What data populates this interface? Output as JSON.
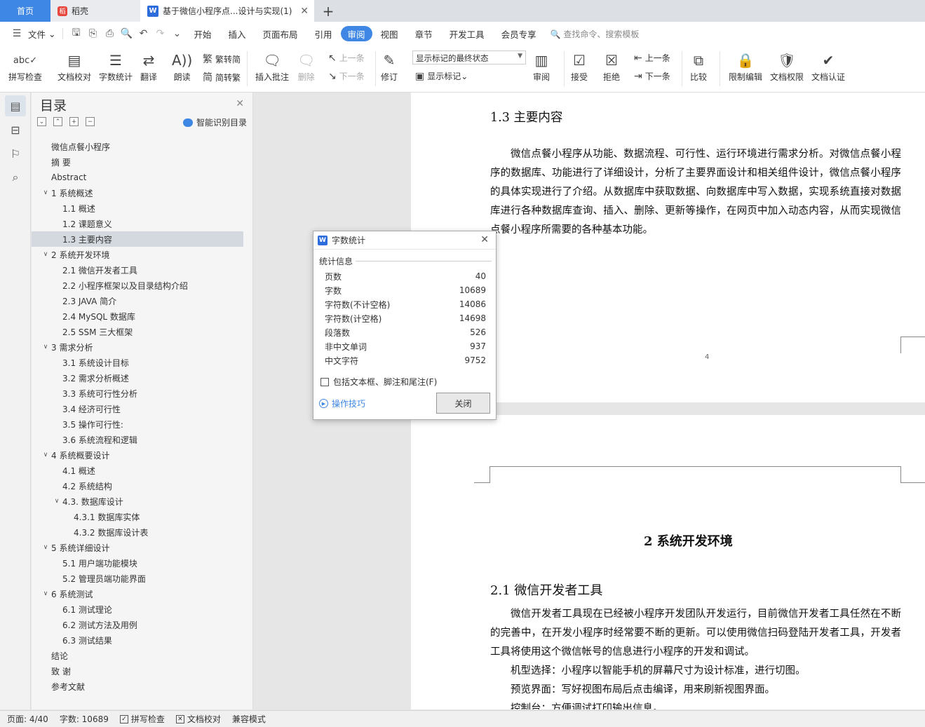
{
  "tabs": {
    "home": "首页",
    "daoke": "稻壳",
    "doc": "基于微信小程序点...设计与实现(1)"
  },
  "menu": {
    "file": "文件",
    "items": [
      "开始",
      "插入",
      "页面布局",
      "引用",
      "审阅",
      "视图",
      "章节",
      "开发工具",
      "会员专享"
    ],
    "active": "审阅",
    "search_placeholder": "查找命令、搜索模板"
  },
  "ribbon": {
    "spell": "拼写检查",
    "proofread": "文档校对",
    "wordcount": "字数统计",
    "translate": "翻译",
    "read": "朗读",
    "trad_to_simp": "繁转简",
    "simp_to_trad": "简转繁",
    "insert_comment": "插入批注",
    "delete": "删除",
    "prev": "上一条",
    "next": "下一条",
    "revise": "修订",
    "markup_state": "显示标记的最终状态",
    "show_markup": "显示标记",
    "review": "审阅",
    "accept": "接受",
    "reject": "拒绝",
    "prev2": "上一条",
    "next2": "下一条",
    "compare": "比较",
    "restrict": "限制编辑",
    "permission": "文档权限",
    "certify": "文档认证"
  },
  "toc": {
    "title": "目录",
    "smart": "智能识别目录",
    "items": [
      {
        "label": "微信点餐小程序",
        "level": 0,
        "caret": ""
      },
      {
        "label": "摘  要",
        "level": 0,
        "caret": ""
      },
      {
        "label": "Abstract",
        "level": 0,
        "caret": ""
      },
      {
        "label": "1  系统概述",
        "level": 0,
        "caret": "v"
      },
      {
        "label": "1.1  概述",
        "level": 1,
        "caret": ""
      },
      {
        "label": "1.2 课题意义",
        "level": 1,
        "caret": ""
      },
      {
        "label": "1.3  主要内容",
        "level": 1,
        "caret": "",
        "selected": true
      },
      {
        "label": "2  系统开发环境",
        "level": 0,
        "caret": "v"
      },
      {
        "label": "2.1 微信开发者工具",
        "level": 1,
        "caret": ""
      },
      {
        "label": "2.2 小程序框架以及目录结构介绍",
        "level": 1,
        "caret": ""
      },
      {
        "label": "2.3 JAVA 简介",
        "level": 1,
        "caret": ""
      },
      {
        "label": "2.4 MySQL 数据库",
        "level": 1,
        "caret": ""
      },
      {
        "label": "2.5 SSM 三大框架",
        "level": 1,
        "caret": ""
      },
      {
        "label": "3  需求分析",
        "level": 0,
        "caret": "v"
      },
      {
        "label": "3.1  系统设计目标",
        "level": 1,
        "caret": ""
      },
      {
        "label": "3.2 需求分析概述",
        "level": 1,
        "caret": ""
      },
      {
        "label": "3.3  系统可行性分析",
        "level": 1,
        "caret": ""
      },
      {
        "label": "3.4 经济可行性",
        "level": 1,
        "caret": ""
      },
      {
        "label": "3.5 操作可行性:",
        "level": 1,
        "caret": ""
      },
      {
        "label": "3.6 系统流程和逻辑",
        "level": 1,
        "caret": ""
      },
      {
        "label": "4 系统概要设计",
        "level": 0,
        "caret": "v"
      },
      {
        "label": "4.1  概述",
        "level": 1,
        "caret": ""
      },
      {
        "label": "4.2  系统结构",
        "level": 1,
        "caret": ""
      },
      {
        "label": "4.3.  数据库设计",
        "level": 1,
        "caret": "v"
      },
      {
        "label": "4.3.1  数据库实体",
        "level": 2,
        "caret": ""
      },
      {
        "label": "4.3.2  数据库设计表",
        "level": 2,
        "caret": ""
      },
      {
        "label": "5 系统详细设计",
        "level": 0,
        "caret": "v"
      },
      {
        "label": "5.1 用户端功能模块",
        "level": 1,
        "caret": ""
      },
      {
        "label": "5.2 管理员端功能界面",
        "level": 1,
        "caret": ""
      },
      {
        "label": "6  系统测试",
        "level": 0,
        "caret": "v"
      },
      {
        "label": "6.1  测试理论",
        "level": 1,
        "caret": ""
      },
      {
        "label": "6.2  测试方法及用例",
        "level": 1,
        "caret": ""
      },
      {
        "label": "6.3 测试结果",
        "level": 1,
        "caret": ""
      },
      {
        "label": "结论",
        "level": 0,
        "caret": ""
      },
      {
        "label": "致    谢",
        "level": 0,
        "caret": ""
      },
      {
        "label": "参考文献",
        "level": 0,
        "caret": ""
      }
    ]
  },
  "doc": {
    "h_13": "1.3  主要内容",
    "p_13": "微信点餐小程序从功能、数据流程、可行性、运行环境进行需求分析。对微信点餐小程序的数据库、功能进行了详细设计，分析了主要界面设计和相关组件设计，微信点餐小程序的具体实现进行了介绍。从数据库中获取数据、向数据库中写入数据，实现系统直接对数据库进行各种数据库查询、插入、删除、更新等操作，在网页中加入动态内容，从而实现微信点餐小程序所需要的各种基本功能。",
    "page_num": "4",
    "h_2": "2  系统开发环境",
    "h_21": "2.1 微信开发者工具",
    "p_21": "微信开发者工具现在已经被小程序开发团队开发运行，目前微信开发者工具任然在不断的完善中，在开发小程序时经常要不断的更新。可以使用微信扫码登陆开发者工具，开发者工具将使用这个微信帐号的信息进行小程序的开发和调试。",
    "p_22": "机型选择：小程序以智能手机的屏幕尺寸为设计标准，进行切图。",
    "p_23": "预览界面：写好视图布局后点击编译，用来刷新视图界面。",
    "p_24": "控制台：方便调试打印输出信息。"
  },
  "dialog": {
    "title": "字数统计",
    "section": "统计信息",
    "rows": [
      {
        "label": "页数",
        "value": "40"
      },
      {
        "label": "字数",
        "value": "10689"
      },
      {
        "label": "字符数(不计空格)",
        "value": "14086"
      },
      {
        "label": "字符数(计空格)",
        "value": "14698"
      },
      {
        "label": "段落数",
        "value": "526"
      },
      {
        "label": "非中文单词",
        "value": "937"
      },
      {
        "label": "中文字符",
        "value": "9752"
      }
    ],
    "checkbox": "包括文本框、脚注和尾注(F)",
    "tips": "操作技巧",
    "close": "关闭"
  },
  "status": {
    "page": "页面: 4/40",
    "words": "字数: 10689",
    "spell": "拼写检查",
    "proof": "文档校对",
    "compat": "兼容模式"
  }
}
